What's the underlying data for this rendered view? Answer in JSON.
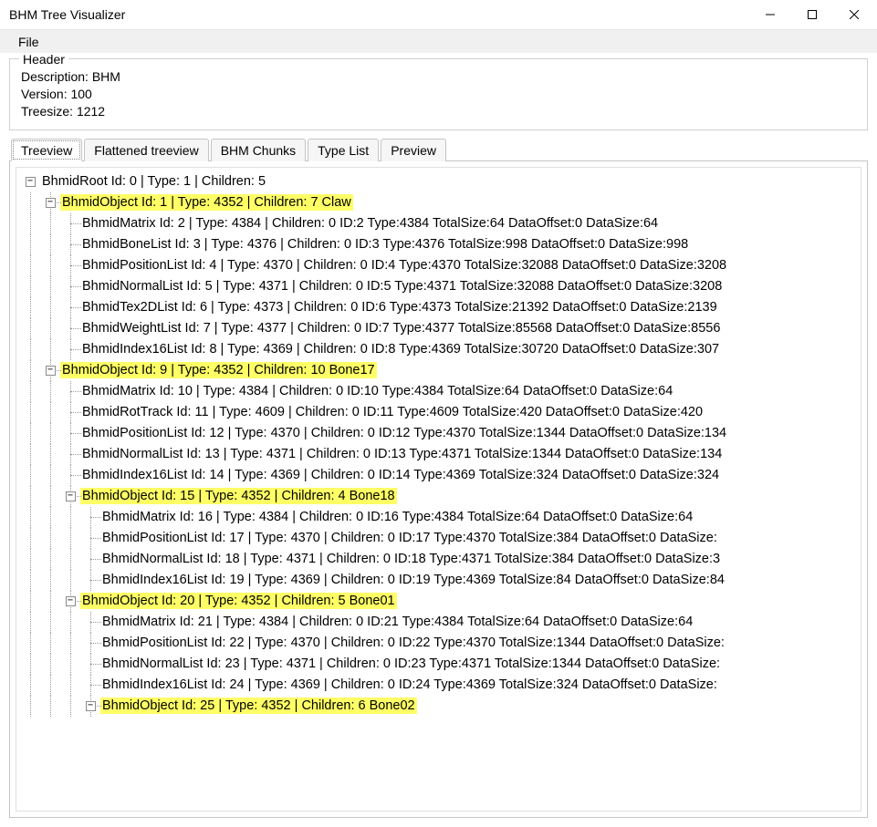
{
  "window": {
    "title": "BHM Tree Visualizer"
  },
  "menu": {
    "file": "File"
  },
  "header": {
    "title": "Header",
    "description_label": "Description:",
    "description_value": "BHM",
    "version_label": "Version:",
    "version_value": "100",
    "treesize_label": "Treesize:",
    "treesize_value": "1212"
  },
  "tabs": {
    "treeview": "Treeview",
    "flattened": "Flattened treeview",
    "chunks": "BHM Chunks",
    "typelist": "Type List",
    "preview": "Preview"
  },
  "tree": {
    "root": "BhmidRoot Id: 0 | Type: 1 | Children: 5",
    "obj1": "BhmidObject Id: 1 | Type: 4352 | Children: 7 Claw",
    "obj1_children": [
      "BhmidMatrix Id: 2 | Type: 4384 | Children: 0  ID:2 Type:4384 TotalSize:64 DataOffset:0 DataSize:64",
      "BhmidBoneList Id: 3 | Type: 4376 | Children: 0  ID:3 Type:4376 TotalSize:998 DataOffset:0 DataSize:998",
      "BhmidPositionList Id: 4 | Type: 4370 | Children: 0  ID:4 Type:4370 TotalSize:32088 DataOffset:0 DataSize:3208",
      "BhmidNormalList Id: 5 | Type: 4371 | Children: 0  ID:5 Type:4371 TotalSize:32088 DataOffset:0 DataSize:3208",
      "BhmidTex2DList Id: 6 | Type: 4373 | Children: 0  ID:6 Type:4373 TotalSize:21392 DataOffset:0 DataSize:2139",
      "BhmidWeightList Id: 7 | Type: 4377 | Children: 0  ID:7 Type:4377 TotalSize:85568 DataOffset:0 DataSize:8556",
      "BhmidIndex16List Id: 8 | Type: 4369 | Children: 0  ID:8 Type:4369 TotalSize:30720 DataOffset:0 DataSize:307"
    ],
    "obj9": "BhmidObject Id: 9 | Type: 4352 | Children: 10 Bone17",
    "obj9_children": [
      "BhmidMatrix Id: 10 | Type: 4384 | Children: 0  ID:10 Type:4384 TotalSize:64 DataOffset:0 DataSize:64",
      "BhmidRotTrack Id: 11 | Type: 4609 | Children: 0  ID:11 Type:4609 TotalSize:420 DataOffset:0 DataSize:420",
      "BhmidPositionList Id: 12 | Type: 4370 | Children: 0  ID:12 Type:4370 TotalSize:1344 DataOffset:0 DataSize:134",
      "BhmidNormalList Id: 13 | Type: 4371 | Children: 0  ID:13 Type:4371 TotalSize:1344 DataOffset:0 DataSize:134",
      "BhmidIndex16List Id: 14 | Type: 4369 | Children: 0  ID:14 Type:4369 TotalSize:324 DataOffset:0 DataSize:324"
    ],
    "obj15": "BhmidObject Id: 15 | Type: 4352 | Children: 4 Bone18",
    "obj15_children": [
      "BhmidMatrix Id: 16 | Type: 4384 | Children: 0  ID:16 Type:4384 TotalSize:64 DataOffset:0 DataSize:64",
      "BhmidPositionList Id: 17 | Type: 4370 | Children: 0  ID:17 Type:4370 TotalSize:384 DataOffset:0 DataSize:",
      "BhmidNormalList Id: 18 | Type: 4371 | Children: 0  ID:18 Type:4371 TotalSize:384 DataOffset:0 DataSize:3",
      "BhmidIndex16List Id: 19 | Type: 4369 | Children: 0  ID:19 Type:4369 TotalSize:84 DataOffset:0 DataSize:84"
    ],
    "obj20": "BhmidObject Id: 20 | Type: 4352 | Children: 5 Bone01",
    "obj20_children": [
      "BhmidMatrix Id: 21 | Type: 4384 | Children: 0  ID:21 Type:4384 TotalSize:64 DataOffset:0 DataSize:64",
      "BhmidPositionList Id: 22 | Type: 4370 | Children: 0  ID:22 Type:4370 TotalSize:1344 DataOffset:0 DataSize:",
      "BhmidNormalList Id: 23 | Type: 4371 | Children: 0  ID:23 Type:4371 TotalSize:1344 DataOffset:0 DataSize:",
      "BhmidIndex16List Id: 24 | Type: 4369 | Children: 0  ID:24 Type:4369 TotalSize:324 DataOffset:0 DataSize:"
    ],
    "obj25": "BhmidObject Id: 25 | Type: 4352 | Children: 6 Bone02"
  }
}
